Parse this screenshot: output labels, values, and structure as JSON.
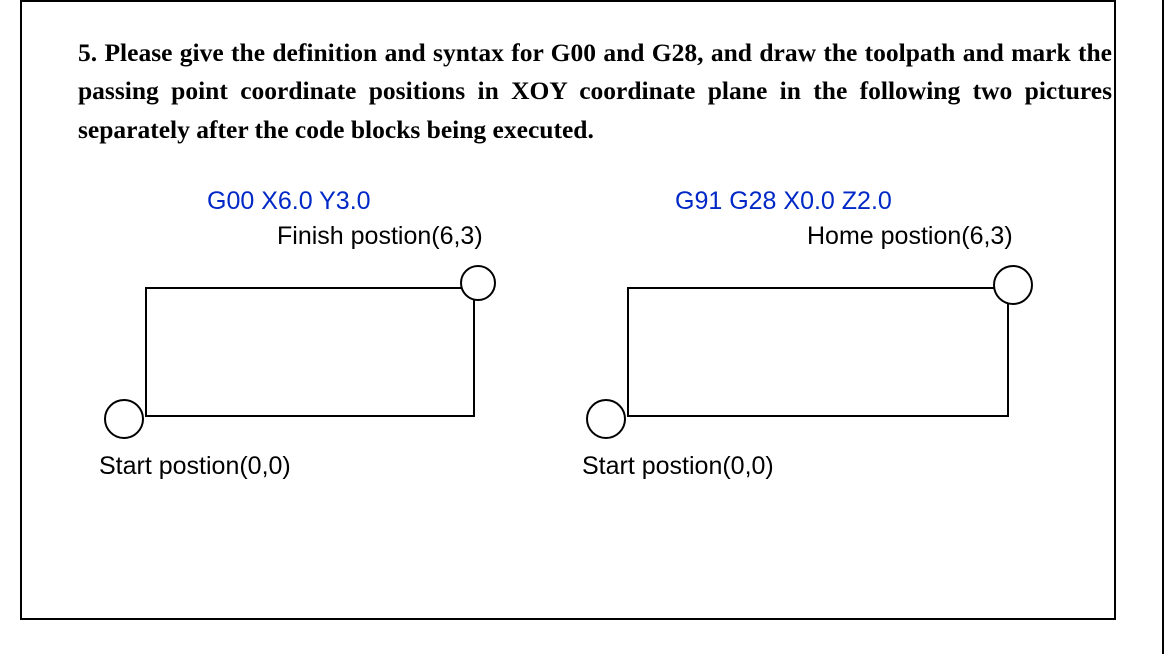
{
  "question": {
    "text": "5. Please give the definition and syntax for G00 and G28, and draw the toolpath and mark the passing point coordinate positions in XOY coordinate plane in the following two pictures separately after the code blocks being executed."
  },
  "panels": {
    "left": {
      "code": "G00 X6.0 Y3.0",
      "top_label": "Finish postion(6,3)",
      "bottom_label": "Start postion(0,0)"
    },
    "right": {
      "code": "G91 G28 X0.0 Z2.0",
      "top_label": "Home postion(6,3)",
      "bottom_label": "Start postion(0,0)"
    }
  },
  "chart_data": [
    {
      "type": "scatter",
      "title": "G00 toolpath",
      "points": [
        {
          "name": "Start",
          "x": 0,
          "y": 0
        },
        {
          "name": "Finish",
          "x": 6,
          "y": 3
        }
      ],
      "xlim": [
        0,
        6
      ],
      "ylim": [
        0,
        3
      ]
    },
    {
      "type": "scatter",
      "title": "G28 toolpath",
      "points": [
        {
          "name": "Start",
          "x": 0,
          "y": 0
        },
        {
          "name": "Home",
          "x": 6,
          "y": 3
        }
      ],
      "xlim": [
        0,
        6
      ],
      "ylim": [
        0,
        3
      ]
    }
  ]
}
